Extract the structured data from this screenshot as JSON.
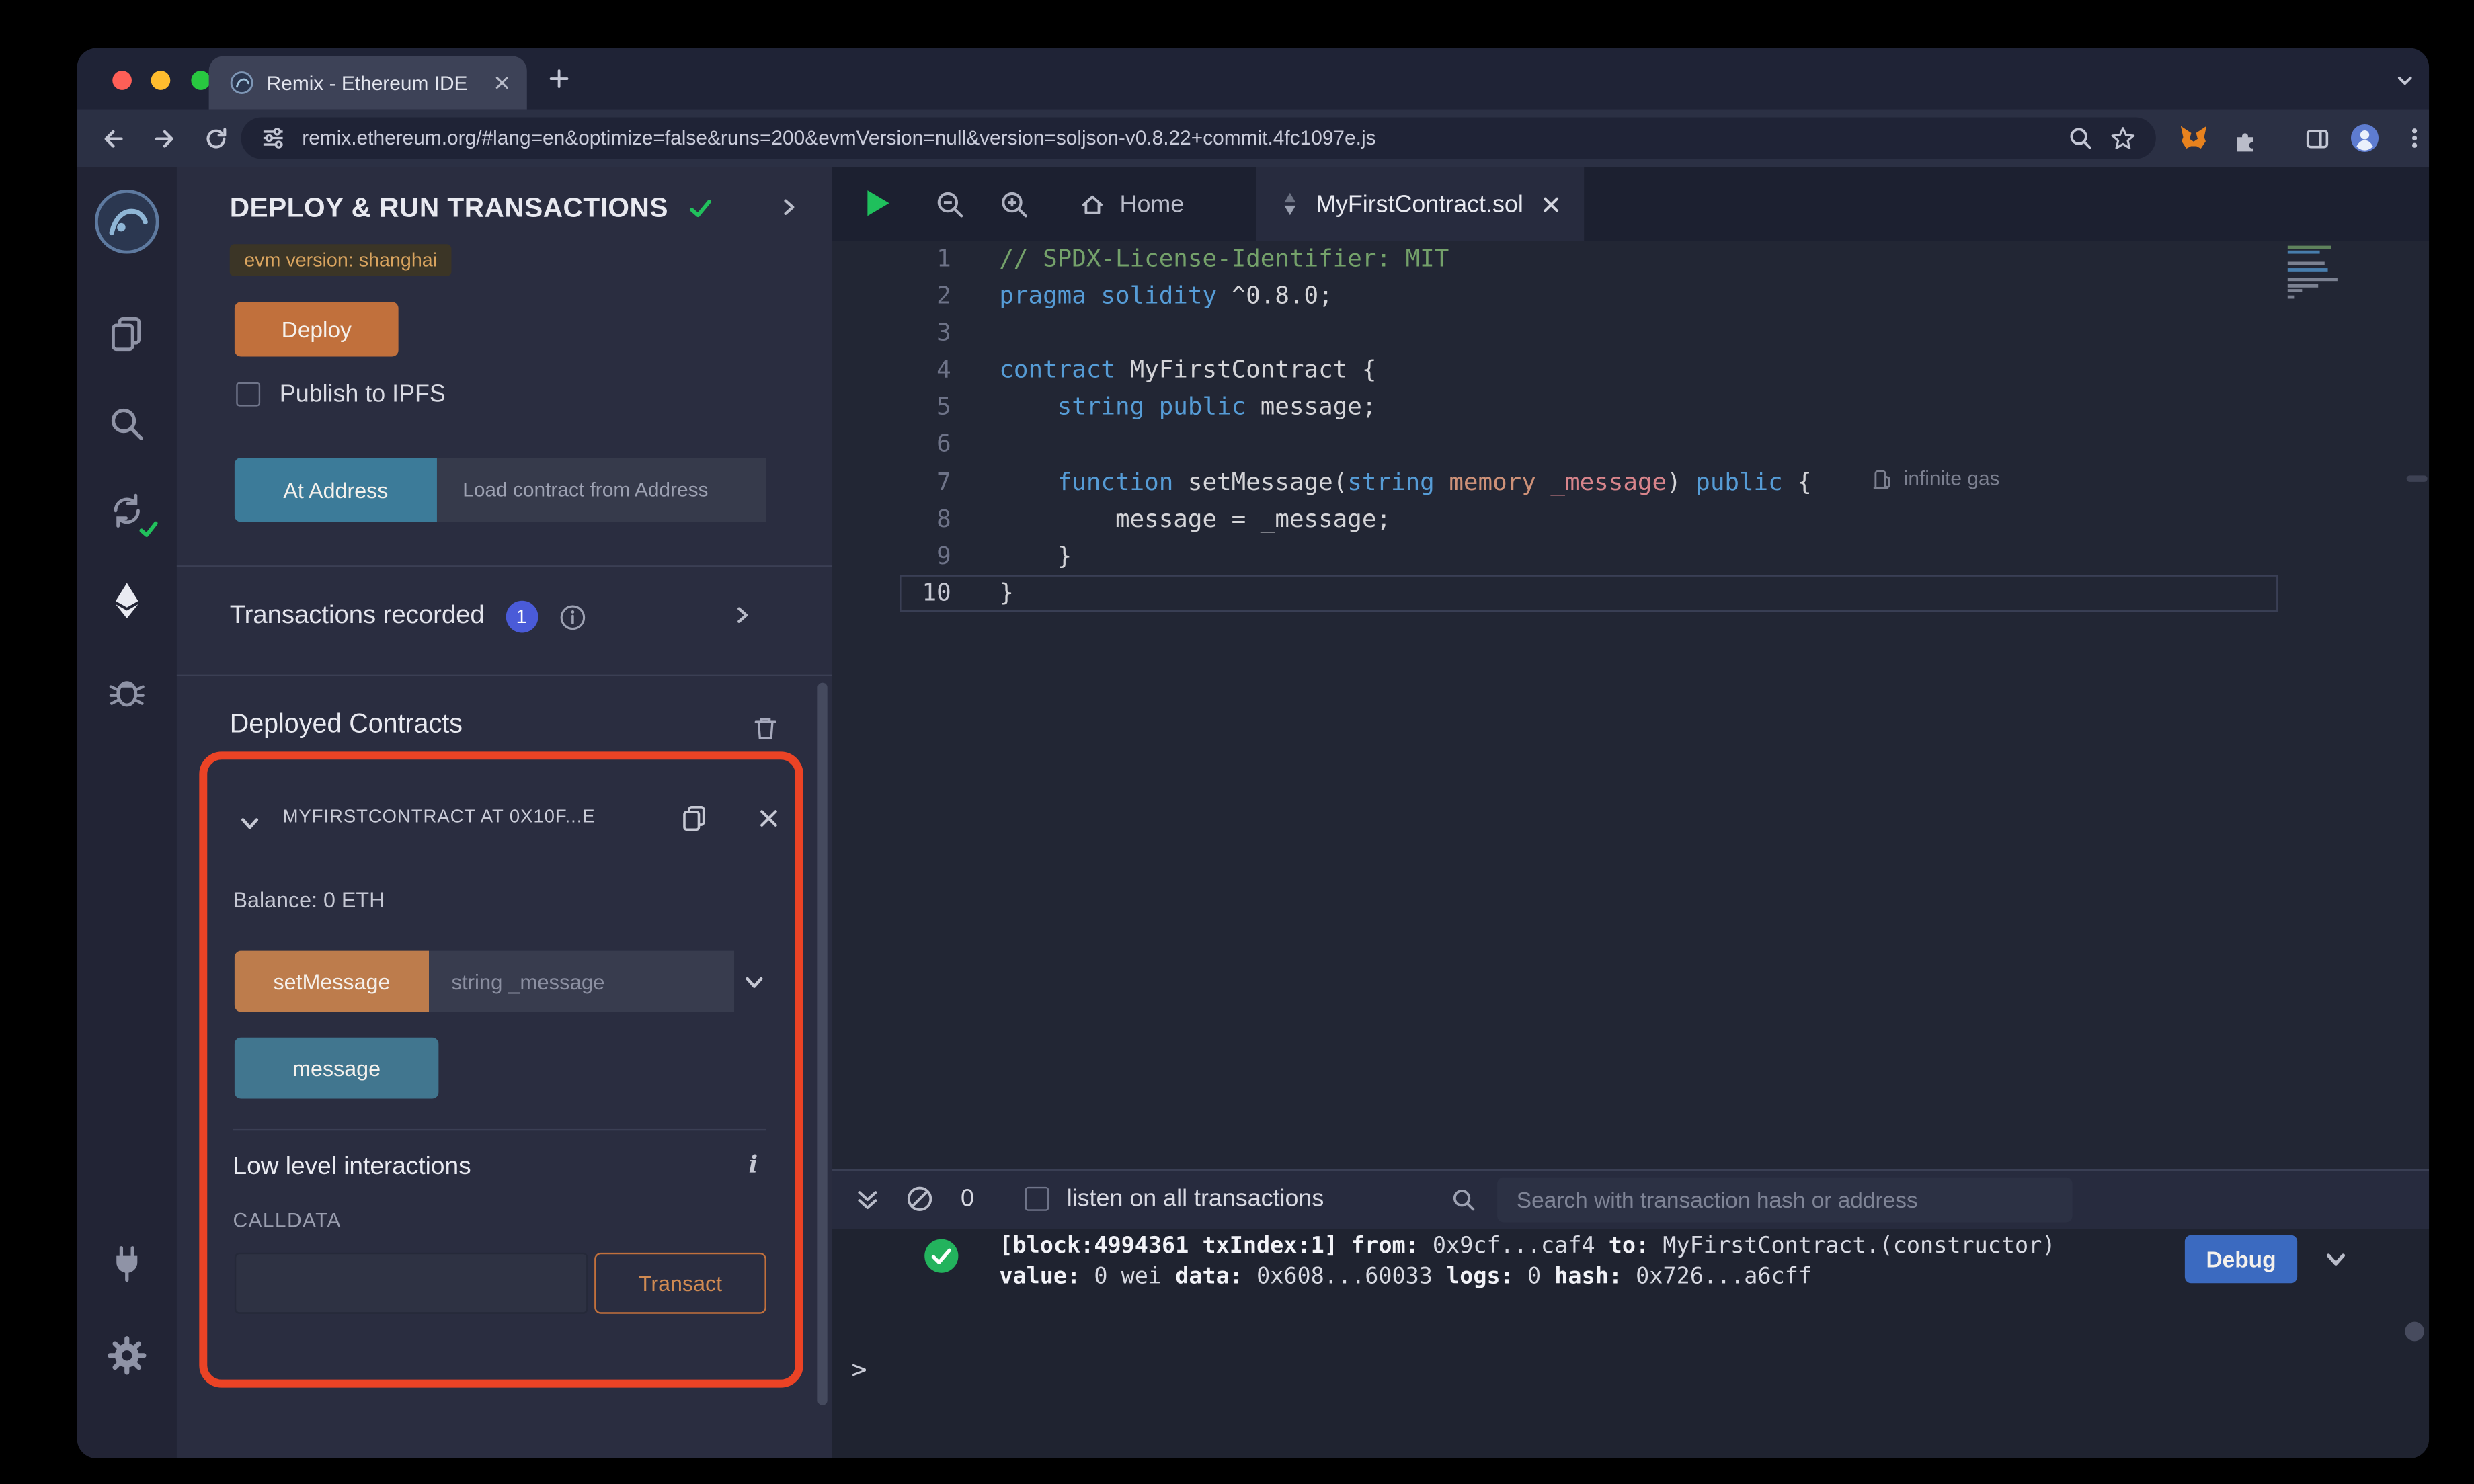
{
  "colors": {
    "accent_orange": "#C1703C",
    "button_teal": "#3C7B99",
    "button_blue": "#3B6AC0",
    "badge_blue": "#4A5BD8",
    "success_green": "#21C05C",
    "annotation_red": "#EB4325"
  },
  "icons": {
    "info_italic": "i"
  },
  "browser": {
    "tab_title": "Remix - Ethereum IDE",
    "url": "remix.ethereum.org/#lang=en&optimize=false&runs=200&evmVersion=null&version=soljson-v0.8.22+commit.4fc1097e.js"
  },
  "panel": {
    "title": "DEPLOY & RUN TRANSACTIONS",
    "evm_badge": "evm version: shanghai",
    "deploy": "Deploy",
    "publish_ipfs": "Publish to IPFS",
    "at_address": "At Address",
    "load_contract": "Load contract from Address",
    "tx_recorded": "Transactions recorded",
    "tx_count": "1",
    "deployed_contracts": "Deployed Contracts",
    "contract_title": "MYFIRSTCONTRACT AT 0X10F...E",
    "balance": "Balance: 0 ETH",
    "set_message": "setMessage",
    "set_message_placeholder": "string _message",
    "message_btn": "message",
    "low_level": "Low level interactions",
    "calldata": "CALLDATA",
    "transact": "Transact"
  },
  "editor": {
    "tab_home": "Home",
    "tab_file": "MyFirstContract.sol",
    "gas_annotation": "infinite gas",
    "active_line": 10,
    "code": [
      {
        "n": 1,
        "tokens": [
          [
            "// SPDX-License-Identifier: MIT",
            "com"
          ]
        ]
      },
      {
        "n": 2,
        "tokens": [
          [
            "pragma",
            "kw"
          ],
          [
            " ",
            ""
          ],
          [
            "solidity",
            "kw"
          ],
          [
            " ^0.8.0;",
            ""
          ]
        ]
      },
      {
        "n": 3,
        "tokens": []
      },
      {
        "n": 4,
        "tokens": [
          [
            "contract",
            "kw"
          ],
          [
            " MyFirstContract {",
            ""
          ]
        ]
      },
      {
        "n": 5,
        "tokens": [
          [
            "    ",
            ""
          ],
          [
            "string",
            "kw"
          ],
          [
            " ",
            ""
          ],
          [
            "public",
            "kw"
          ],
          [
            " message;",
            ""
          ]
        ]
      },
      {
        "n": 6,
        "tokens": []
      },
      {
        "n": 7,
        "tokens": [
          [
            "    ",
            ""
          ],
          [
            "function",
            "kw"
          ],
          [
            " setMessage(",
            ""
          ],
          [
            "string",
            "kw"
          ],
          [
            " ",
            ""
          ],
          [
            "memory",
            "mem"
          ],
          [
            " _message",
            "param"
          ],
          [
            ") ",
            ""
          ],
          [
            "public",
            "kw"
          ],
          [
            " {",
            ""
          ]
        ]
      },
      {
        "n": 8,
        "tokens": [
          [
            "        message = _message;",
            ""
          ]
        ]
      },
      {
        "n": 9,
        "tokens": [
          [
            "    }",
            ""
          ]
        ]
      },
      {
        "n": 10,
        "tokens": [
          [
            "}",
            ""
          ]
        ]
      }
    ]
  },
  "terminal": {
    "badge_count": "0",
    "listen_label": "listen on all transactions",
    "search_placeholder": "Search with transaction hash or address",
    "log": [
      [
        [
          "[block:4994361 txIndex:1]",
          true
        ],
        [
          " ",
          false
        ],
        [
          "from:",
          true
        ],
        [
          " 0x9cf...caf4 ",
          false
        ],
        [
          "to:",
          true
        ],
        [
          " MyFirstContract.(constructor)",
          false
        ]
      ],
      [
        [
          "value:",
          true
        ],
        [
          " 0 wei ",
          false
        ],
        [
          "data:",
          true
        ],
        [
          " 0x608...60033 ",
          false
        ],
        [
          "logs:",
          true
        ],
        [
          " 0 ",
          false
        ],
        [
          "hash:",
          true
        ],
        [
          " 0x726...a6cff",
          false
        ]
      ]
    ],
    "debug": "Debug",
    "prompt": ">"
  }
}
